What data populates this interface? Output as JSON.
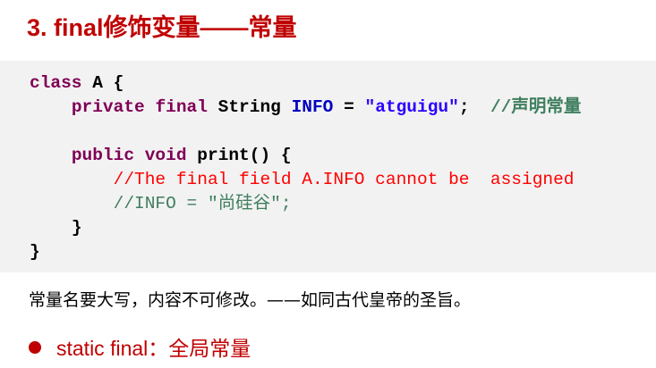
{
  "title": "3. final修饰变量——常量",
  "code": {
    "line1": {
      "kw": "class",
      "rest": " A {"
    },
    "line2": {
      "kw1": "private",
      "kw2": "final",
      "type": "String",
      "name": "INFO",
      "eq": " = ",
      "str": "\"atguigu\"",
      "semi": ";  ",
      "comment": "//声明常量"
    },
    "line3": {
      "kw1": "public",
      "kw2": "void",
      "rest": " print() {"
    },
    "line4": {
      "comment": "//The final field A.INFO cannot be  assigned"
    },
    "line5": {
      "comment": "//INFO = \"尚硅谷\";"
    },
    "line6": {
      "rest": "}"
    },
    "line7": {
      "rest": "}"
    }
  },
  "description": "常量名要大写，内容不可修改。——如同古代皇帝的圣旨。",
  "bullet": {
    "label": "static final：",
    "text": "全局常量"
  },
  "colors": {
    "title": "#c00000",
    "keyword": "#7f0055",
    "comment_green": "#3f7f5f",
    "comment_red": "#ff0000",
    "string": "#2a00ff",
    "bullet": "#c00000",
    "code_bg": "#f2f2f2"
  }
}
